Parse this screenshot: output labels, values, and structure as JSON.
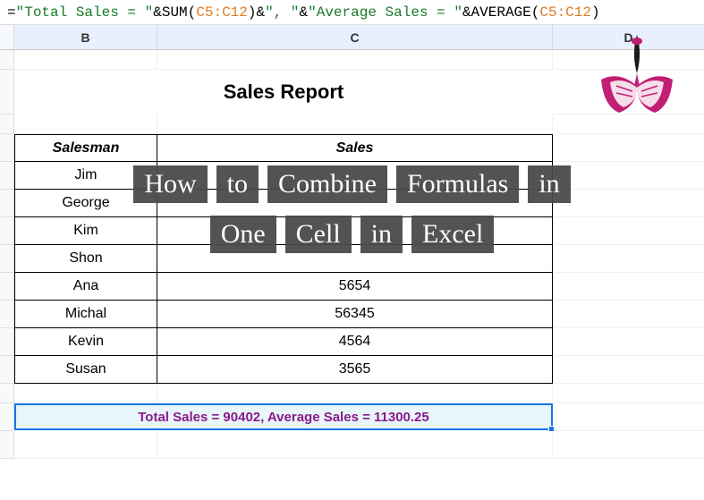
{
  "formula_bar": {
    "eq": "=",
    "str1": "\"Total Sales = \"",
    "amp1": "&",
    "func1": "SUM",
    "open1": "(",
    "range1": "C5:C12",
    "close1": ")",
    "amp2": "&",
    "str2": "\", \"",
    "amp3": "&",
    "str3": "\"Average Sales = \"",
    "amp4": "&",
    "func2": "AVERAGE",
    "open2": "(",
    "range2": "C5:C12",
    "close2": ")"
  },
  "columns": {
    "b": "B",
    "c": "C",
    "d": "D"
  },
  "title": "Sales Report",
  "headers": {
    "salesman": "Salesman",
    "sales": "Sales"
  },
  "rows": [
    {
      "name": "Jim",
      "sales": ""
    },
    {
      "name": "George",
      "sales": ""
    },
    {
      "name": "Kim",
      "sales": ""
    },
    {
      "name": "Shon",
      "sales": ""
    },
    {
      "name": "Ana",
      "sales": "5654"
    },
    {
      "name": "Michal",
      "sales": "56345"
    },
    {
      "name": "Kevin",
      "sales": "4564"
    },
    {
      "name": "Susan",
      "sales": "3565"
    }
  ],
  "result": "Total Sales = 90402, Average Sales = 11300.25",
  "overlay": {
    "line1": [
      "How",
      "to",
      "Combine",
      "Formulas",
      "in"
    ],
    "line2": [
      "One",
      "Cell",
      "in",
      "Excel"
    ]
  },
  "chart_data": {
    "type": "table",
    "title": "Sales Report",
    "columns": [
      "Salesman",
      "Sales"
    ],
    "rows": [
      [
        "Jim",
        null
      ],
      [
        "George",
        null
      ],
      [
        "Kim",
        null
      ],
      [
        "Shon",
        null
      ],
      [
        "Ana",
        5654
      ],
      [
        "Michal",
        56345
      ],
      [
        "Kevin",
        4564
      ],
      [
        "Susan",
        3565
      ]
    ],
    "summary": {
      "total_sales": 90402,
      "average_sales": 11300.25
    }
  }
}
